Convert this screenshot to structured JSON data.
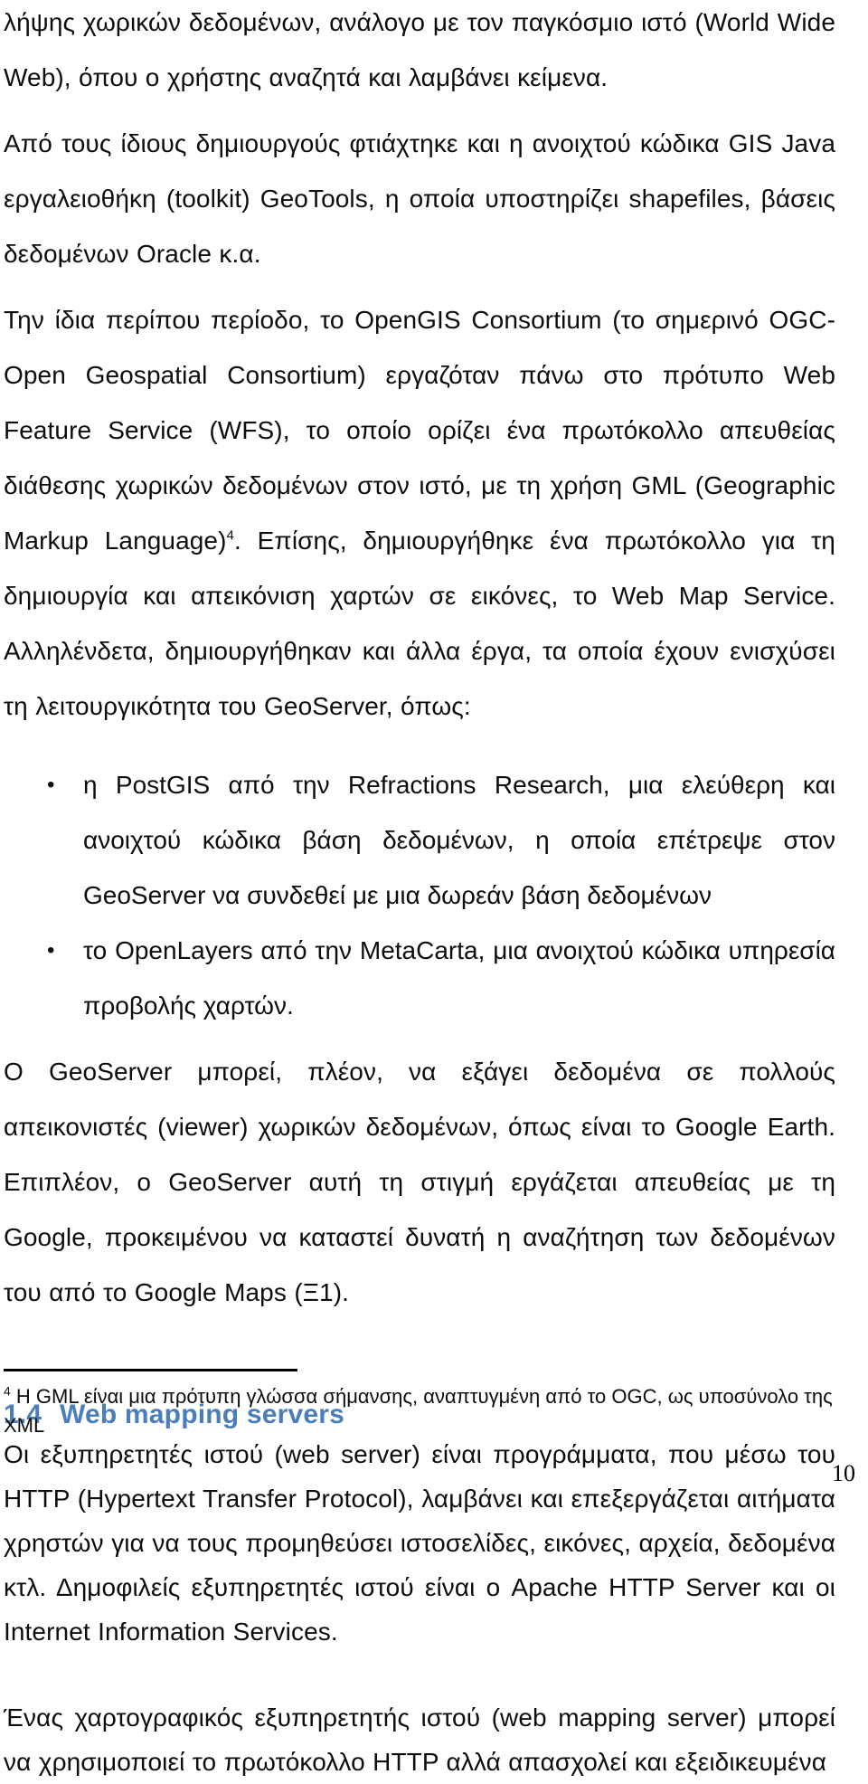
{
  "document": {
    "page_number": "10",
    "language": "el"
  },
  "body": {
    "paragraphs": [
      {
        "id": "p1",
        "text": "λήψης χωρικών δεδομένων, ανάλογο με τον παγκόσμιο ιστό (World Wide Web), όπου ο χρήστης αναζητά και λαμβάνει κείμενα."
      },
      {
        "id": "p2",
        "text": "Από τους ίδιους δημιουργούς φτιάχτηκε και η ανοιχτού κώδικα GIS Java εργαλειοθήκη (toolkit) GeoTools, η οποία υποστηρίζει shapefiles, βάσεις δεδομένων Oracle κ.α."
      },
      {
        "id": "p3_part1",
        "text": "Την ίδια περίπου περίοδο, το OpenGIS Consortium (το σημερινό OGC-Open Geospatial Consortium) εργαζόταν πάνω στο πρότυπο Web Feature Service (WFS), το οποίο ορίζει ένα πρωτόκολλο απευθείας διάθεσης χωρικών δεδομένων στον ιστό, με τη χρήση GML (Geographic Markup Language)"
      },
      {
        "id": "p3_footnote_marker",
        "text": "4"
      },
      {
        "id": "p3_part2",
        "text": ". Επίσης, δημιουργήθηκε ένα πρωτόκολλο για τη δημιουργία και απεικόνιση χαρτών σε εικόνες, το Web Map Service. Αλληλένδετα, δημιουργήθηκαν και άλλα έργα, τα οποία έχουν ενισχύσει τη λειτουργικότητα του GeoServer, όπως:"
      },
      {
        "id": "p4",
        "text": "Ο GeoServer μπορεί, πλέον, να εξάγει δεδομένα σε πολλούς απεικονιστές (viewer) χωρικών δεδομένων, όπως είναι το Google Earth. Επιπλέον, ο GeoServer αυτή τη στιγμή εργάζεται απευθείας με τη Google, προκειμένου να καταστεί δυνατή η αναζήτηση των δεδομένων του από το Google Maps (Ξ1)."
      }
    ],
    "bullets": {
      "marker": "•",
      "items": [
        {
          "id": "b1",
          "text": "η PostGIS από την Refractions Research, μια ελεύθερη και ανοιχτού κώδικα βάση δεδομένων, η οποία επέτρεψε στον GeoServer να συνδεθεί με μια δωρεάν βάση δεδομένων"
        },
        {
          "id": "b2",
          "text": "το OpenLayers από την MetaCarta, μια ανοιχτού κώδικα υπηρεσία προβολής χαρτών."
        }
      ]
    },
    "section": {
      "number": "1.4",
      "title": "Web mapping servers",
      "color": "#4a7ebb",
      "paragraphs": [
        {
          "id": "s1",
          "text": "Οι εξυπηρετητές ιστού (web server) είναι προγράμματα, που μέσω του HTTP (Hypertext Transfer Protocol), λαμβάνει και επεξεργάζεται αιτήματα χρηστών για να τους προμηθεύσει ιστοσελίδες, εικόνες, αρχεία, δεδομένα κτλ. Δημοφιλείς εξυπηρετητές ιστού είναι ο Apache HTTP Server και οι Internet Information Services."
        },
        {
          "id": "s2",
          "text": "Ένας χαρτογραφικός εξυπηρετητής ιστού (web mapping server) μπορεί να χρησιμοποιεί το πρωτόκολλο HTTP αλλά απασχολεί και εξειδικευμένα"
        }
      ]
    }
  },
  "footnote": {
    "marker": "4",
    "text": " Η GML είναι μια πρότυπη γλώσσα σήμανσης, αναπτυγμένη από το OGC, ως υποσύνολο της XML"
  }
}
